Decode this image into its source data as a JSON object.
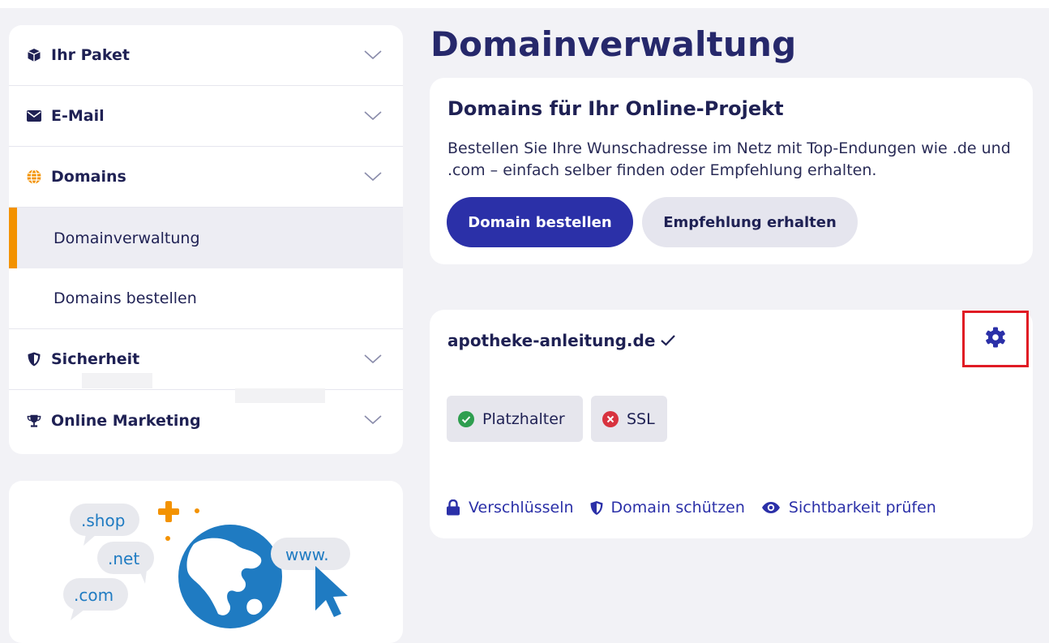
{
  "sidebar": {
    "items": [
      {
        "label": "Ihr Paket",
        "icon": "package-icon"
      },
      {
        "label": "E-Mail",
        "icon": "envelope-icon"
      },
      {
        "label": "Domains",
        "icon": "globe-icon"
      },
      {
        "label": "Sicherheit",
        "icon": "shield-icon"
      },
      {
        "label": "Online Marketing",
        "icon": "trophy-icon"
      }
    ],
    "sub_items": [
      {
        "label": "Domainverwaltung",
        "active": true
      },
      {
        "label": "Domains bestellen",
        "active": false
      }
    ]
  },
  "promo": {
    "tags": [
      ".shop",
      ".net",
      ".com",
      "www."
    ]
  },
  "main": {
    "title": "Domainverwaltung",
    "intro_card": {
      "heading": "Domains für Ihr Online-Projekt",
      "description": "Bestellen Sie Ihre Wunschadresse im Netz mit Top-Endungen wie .de und .com – einfach selber finden oder Empfehlung erhalten.",
      "primary_button": "Domain bestellen",
      "secondary_button": "Empfehlung erhalten"
    },
    "domain_card": {
      "domain": "apotheke-anleitung.de",
      "badges": [
        {
          "label": "Platzhalter",
          "status": "ok"
        },
        {
          "label": "SSL",
          "status": "error"
        }
      ],
      "actions": [
        {
          "label": "Verschlüsseln",
          "icon": "lock-icon"
        },
        {
          "label": "Domain schützen",
          "icon": "shield-icon"
        },
        {
          "label": "Sichtbarkeit prüfen",
          "icon": "eye-icon"
        }
      ]
    }
  },
  "colors": {
    "primary": "#2b30a8",
    "heading": "#26286b",
    "accent_orange": "#f39200",
    "globe_blue": "#1f7bc2",
    "success": "#2e9e4f",
    "error": "#d8333f",
    "highlight_box": "#e01b24"
  }
}
